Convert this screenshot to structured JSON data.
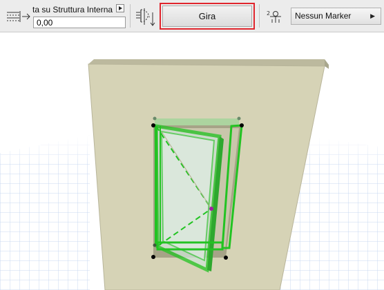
{
  "toolbar": {
    "anchor_label": "ta su Struttura Interna",
    "offset_value": "0,00",
    "flip_button_label": "Gira",
    "marker_select_value": "Nessun Marker",
    "highlight_color": "#e0242c",
    "icons": [
      "anchor-offset-icon",
      "expand-arrow-icon",
      "flip-direction-icon",
      "marker-icon",
      "dropdown-arrow-icon"
    ]
  },
  "viewport": {
    "wall_color": "#d6d3b6",
    "selection_color": "#22c322",
    "ground_grid_color": "#c8d8f0"
  }
}
